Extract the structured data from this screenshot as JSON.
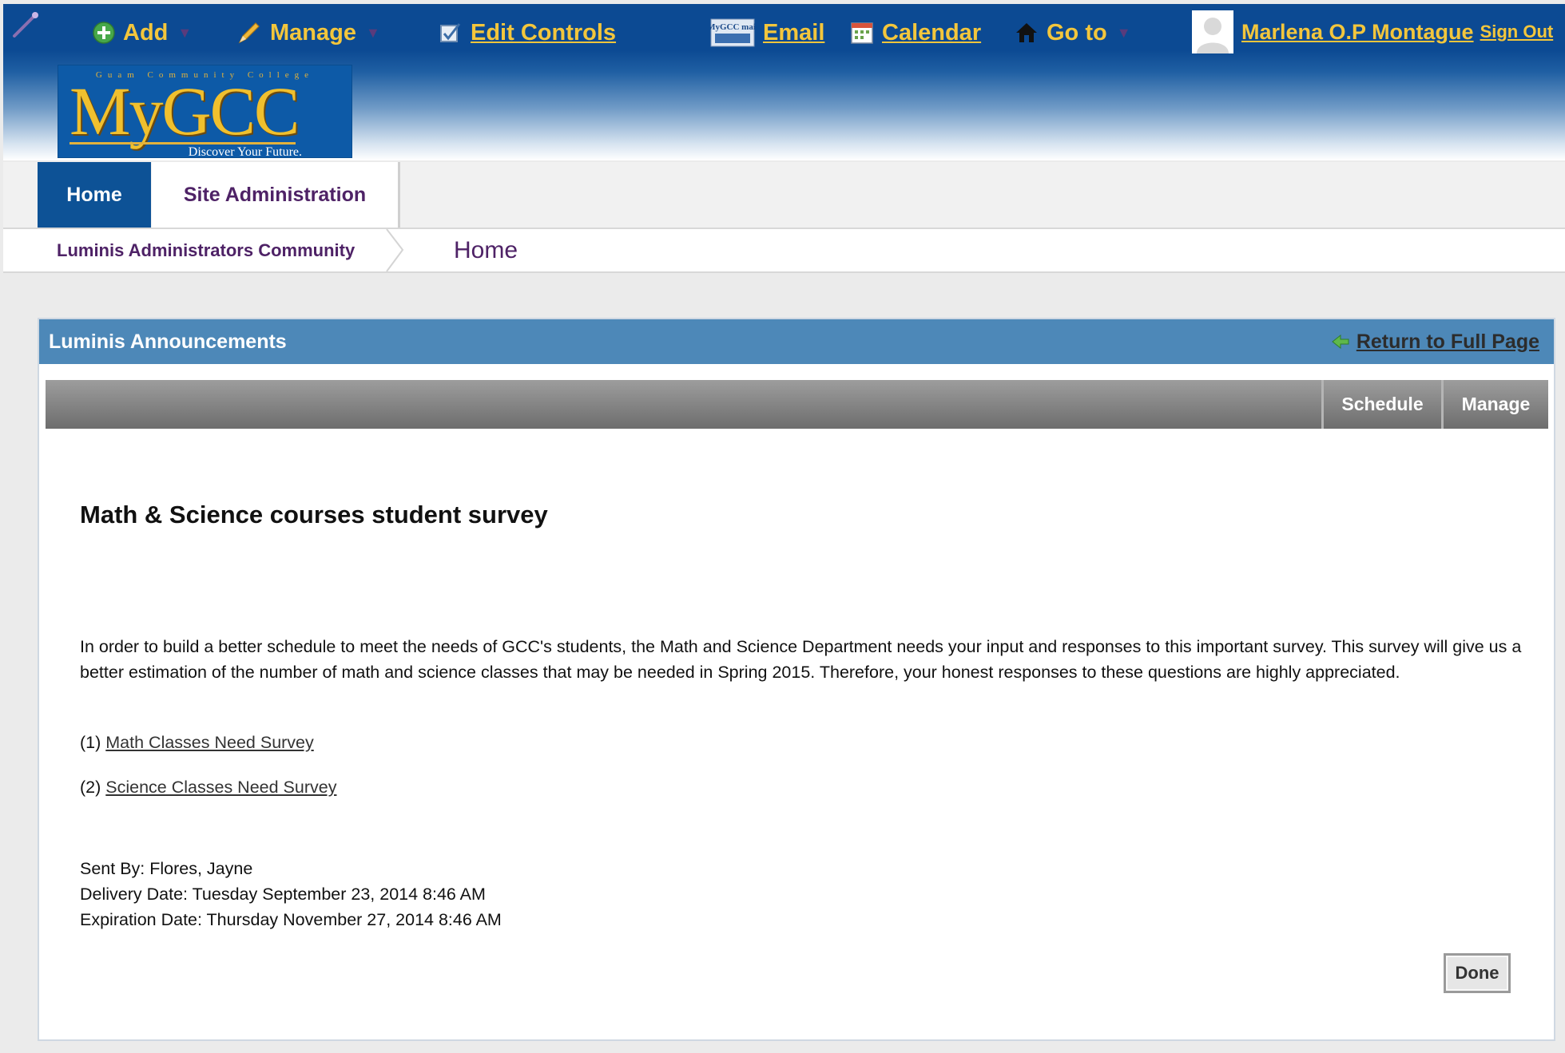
{
  "topbar": {
    "add_label": "Add",
    "manage_label": "Manage",
    "edit_controls_label": "Edit Controls",
    "email_label": "Email",
    "email_icon_text": "MyGCC mail",
    "calendar_label": "Calendar",
    "goto_label": "Go to",
    "user_name": "Marlena O.P Montague",
    "sign_out_label": "Sign Out",
    "text_color": "#f3c63c",
    "background_color": "#0c4a93"
  },
  "logo": {
    "college_text": "Guam Community College",
    "brand_text": "MyGCC",
    "tagline": "Discover Your Future."
  },
  "tabs": [
    {
      "label": "Home",
      "active": true
    },
    {
      "label": "Site Administration",
      "active": false
    }
  ],
  "breadcrumb": {
    "community": "Luminis Administrators Community",
    "page": "Home"
  },
  "portlet": {
    "title": "Luminis Announcements",
    "return_label": "Return to Full Page",
    "toolbar": {
      "schedule_label": "Schedule",
      "manage_label": "Manage"
    },
    "header_color": "#4d88b8"
  },
  "announcement": {
    "title": "Math & Science courses student survey",
    "body": "In order to build a better schedule to meet the needs of GCC's students, the Math and Science Department needs your input and responses to this important survey. This survey will give us a better estimation of the number of math and science classes that may be needed in Spring 2015. Therefore, your honest responses to these questions are highly appreciated.",
    "links": [
      {
        "prefix": "(1)",
        "label": "Math Classes Need Survey"
      },
      {
        "prefix": "(2)",
        "label": "Science Classes Need Survey"
      }
    ],
    "sent_by": "Sent By: Flores, Jayne",
    "delivery_date": "Delivery Date: Tuesday September 23, 2014 8:46 AM",
    "expiration_date": "Expiration Date: Thursday November 27, 2014 8:46 AM",
    "done_label": "Done"
  }
}
